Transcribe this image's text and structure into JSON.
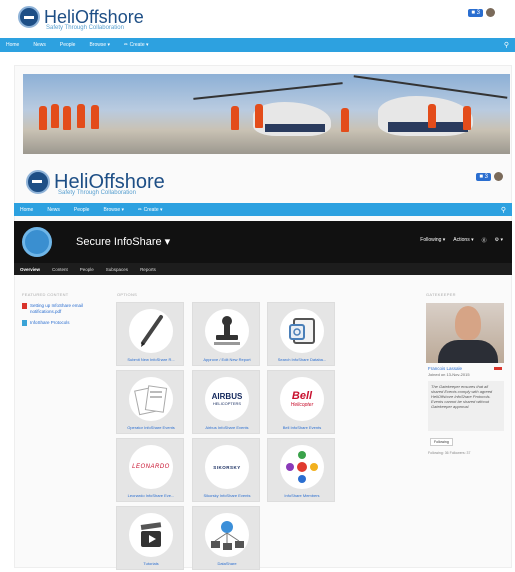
{
  "top": {
    "brand": "HeliOffshore",
    "tagline": "Safety Through Collaboration",
    "badge": "3"
  },
  "nav": {
    "items": [
      "Home",
      "News",
      "People",
      "Browse ▾",
      "✏ Create ▾"
    ]
  },
  "page": {
    "title": "Secure InfoShare ▾",
    "actions": [
      "Following ▾",
      "Actions ▾",
      "⓪",
      "⚙ ▾"
    ],
    "tabs": [
      "Overview",
      "Content",
      "People",
      "Subspaces",
      "Reports"
    ],
    "featured_heading": "FEATURED CONTENT",
    "featured": [
      "Setting up InfoShare email notifications.pdf",
      "InfoShare Protocols"
    ],
    "options_heading": "OPTIONS",
    "tiles": [
      "Submit New InfoShare R...",
      "Approve / Edit New Report",
      "Search InfoShare Databa...",
      "Operator InfoShare Events",
      "Airbus InfoShare Events",
      "Bell InfoShare Events",
      "Leonardo InfoShare Eve...",
      "Sikorsky InfoShare Events",
      "InfoShare Members",
      "Tutorials",
      "DataShare"
    ],
    "logos": {
      "airbus": "AIRBUS",
      "airbus_sub": "HELICOPTERS",
      "bell": "Bell",
      "bell_sub": "Helicopter",
      "leonardo": "LEONARDO",
      "sikorsky": "SIKORSKY"
    },
    "gatekeeper_heading": "GATEKEEPER",
    "gatekeeper": {
      "name": "Francois Lassale",
      "joined": "Joined on 13-Nov-2015",
      "note": "The Gatekeeper ensures that all shared Events comply with agreed HeliOffshore InfoShare Protocols. Events cannot be shared without Gatekeeper approval.",
      "button": "Following",
      "stats": "Following: 36   Followers: 37"
    }
  },
  "colors": {
    "nav": "#2da1e0",
    "brand": "#1e4f86",
    "link": "#2a6ed0"
  }
}
